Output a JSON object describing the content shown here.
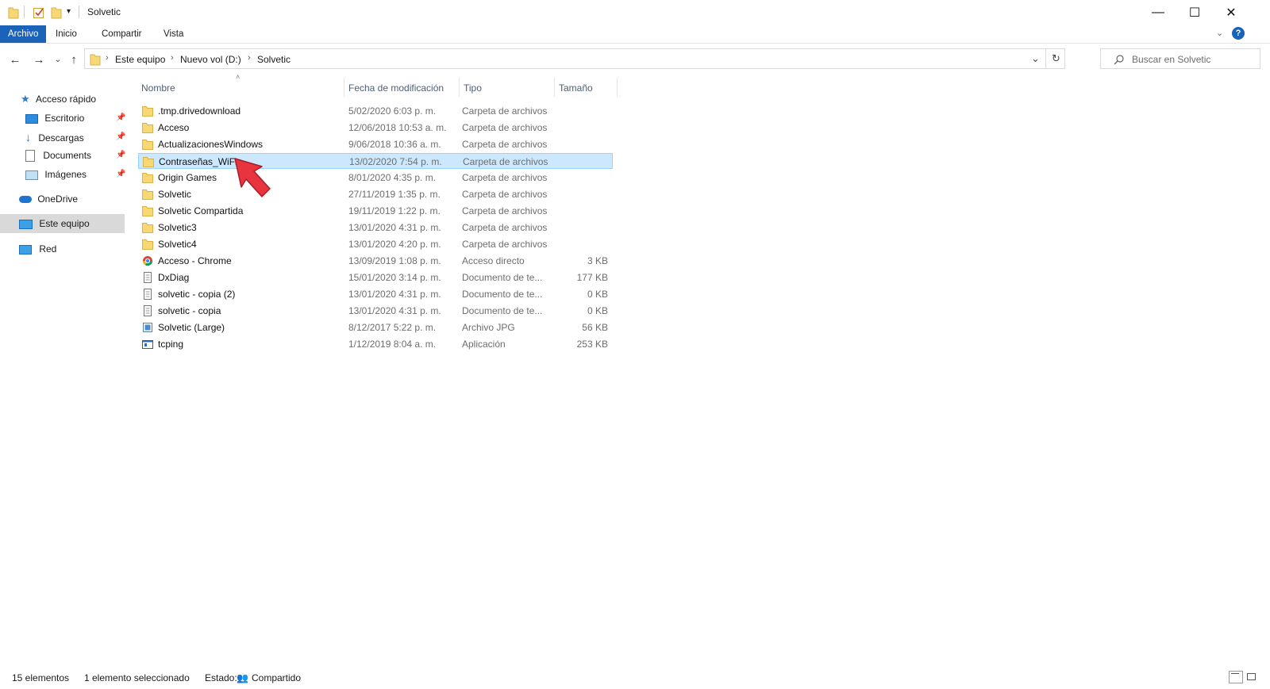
{
  "window": {
    "title": "Solvetic",
    "controls": {
      "minimize": "—",
      "maximize": "☐",
      "close": "✕"
    }
  },
  "ribbon": {
    "tabs": [
      "Archivo",
      "Inicio",
      "Compartir",
      "Vista"
    ],
    "help": "?"
  },
  "address": {
    "crumbs": [
      "Este equipo",
      "Nuevo vol (D:)",
      "Solvetic"
    ]
  },
  "search": {
    "placeholder": "Buscar en Solvetic"
  },
  "sidebar": {
    "items": [
      {
        "label": "Acceso rápido",
        "icon": "star-icon"
      },
      {
        "label": "Escritorio",
        "icon": "desktop-icon",
        "pinned": true
      },
      {
        "label": "Descargas",
        "icon": "download-icon",
        "pinned": true
      },
      {
        "label": "Documents",
        "icon": "document-icon",
        "pinned": true
      },
      {
        "label": "Imágenes",
        "icon": "image-icon",
        "pinned": true
      },
      {
        "label": "OneDrive",
        "icon": "cloud-icon"
      },
      {
        "label": "Este equipo",
        "icon": "computer-icon",
        "selected": true
      },
      {
        "label": "Red",
        "icon": "network-icon"
      }
    ]
  },
  "columns": {
    "name": "Nombre",
    "date": "Fecha de modificación",
    "type": "Tipo",
    "size": "Tamaño"
  },
  "files": [
    {
      "name": ".tmp.drivedownload",
      "date": "5/02/2020 6:03 p. m.",
      "type": "Carpeta de archivos",
      "size": "",
      "icon": "folder-icon"
    },
    {
      "name": "Acceso",
      "date": "12/06/2018 10:53 a. m.",
      "type": "Carpeta de archivos",
      "size": "",
      "icon": "folder-icon"
    },
    {
      "name": "ActualizacionesWindows",
      "date": "9/06/2018 10:36 a. m.",
      "type": "Carpeta de archivos",
      "size": "",
      "icon": "folder-icon"
    },
    {
      "name": "Contraseñas_WiFi",
      "date": "13/02/2020 7:54 p. m.",
      "type": "Carpeta de archivos",
      "size": "",
      "icon": "folder-icon",
      "selected": true
    },
    {
      "name": "Origin Games",
      "date": "8/01/2020 4:35 p. m.",
      "type": "Carpeta de archivos",
      "size": "",
      "icon": "folder-icon"
    },
    {
      "name": "Solvetic",
      "date": "27/11/2019 1:35 p. m.",
      "type": "Carpeta de archivos",
      "size": "",
      "icon": "folder-icon"
    },
    {
      "name": "Solvetic Compartida",
      "date": "19/11/2019 1:22 p. m.",
      "type": "Carpeta de archivos",
      "size": "",
      "icon": "folder-icon"
    },
    {
      "name": "Solvetic3",
      "date": "13/01/2020 4:31 p. m.",
      "type": "Carpeta de archivos",
      "size": "",
      "icon": "folder-icon"
    },
    {
      "name": "Solvetic4",
      "date": "13/01/2020 4:20 p. m.",
      "type": "Carpeta de archivos",
      "size": "",
      "icon": "folder-icon"
    },
    {
      "name": "Acceso - Chrome",
      "date": "13/09/2019 1:08 p. m.",
      "type": "Acceso directo",
      "size": "3 KB",
      "icon": "chrome-shortcut-icon"
    },
    {
      "name": "DxDiag",
      "date": "15/01/2020 3:14 p. m.",
      "type": "Documento de te...",
      "size": "177 KB",
      "icon": "text-file-icon"
    },
    {
      "name": "solvetic - copia (2)",
      "date": "13/01/2020 4:31 p. m.",
      "type": "Documento de te...",
      "size": "0 KB",
      "icon": "text-file-icon"
    },
    {
      "name": "solvetic - copia",
      "date": "13/01/2020 4:31 p. m.",
      "type": "Documento de te...",
      "size": "0 KB",
      "icon": "text-file-icon"
    },
    {
      "name": "Solvetic (Large)",
      "date": "8/12/2017 5:22 p. m.",
      "type": "Archivo JPG",
      "size": "56 KB",
      "icon": "image-file-icon"
    },
    {
      "name": "tcping",
      "date": "1/12/2019 8:04 a. m.",
      "type": "Aplicación",
      "size": "253 KB",
      "icon": "application-icon"
    }
  ],
  "status": {
    "count": "15 elementos",
    "selected": "1 elemento seleccionado",
    "state_label": "Estado:",
    "state_value": "Compartido"
  },
  "colors": {
    "accent": "#1a63b8",
    "selection": "#cce8ff",
    "selection_border": "#99d1ff",
    "folder": "#f8d775",
    "annotation_arrow": "#e8343f"
  }
}
